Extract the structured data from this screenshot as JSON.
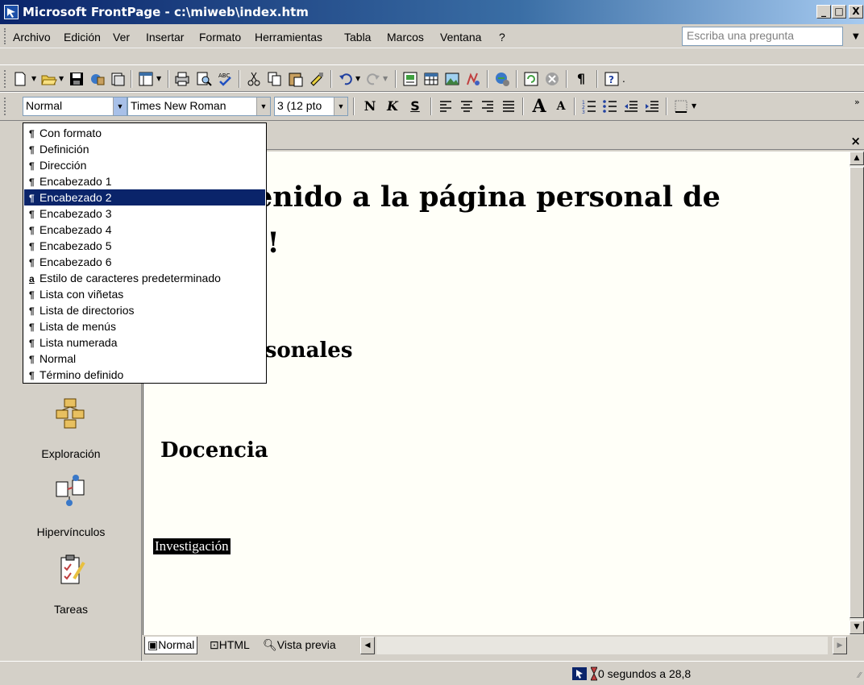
{
  "window": {
    "title": "Microsoft FrontPage - c:\\miweb\\index.htm",
    "minimize": "_",
    "maximize": "□",
    "close": "X"
  },
  "menubar": {
    "items": [
      "Archivo",
      "Edición",
      "Ver",
      "Insertar",
      "Formato",
      "Herramientas",
      "Tabla",
      "Marcos",
      "Ventana",
      "?"
    ],
    "ask_placeholder": "Escriba una pregunta"
  },
  "format_toolbar": {
    "style_value": "Normal",
    "font_value": "Times New Roman",
    "size_value": "3  (12 pto",
    "bold": "N",
    "italic": "K",
    "underline": "S",
    "grow_font": "A",
    "shrink_font": "A"
  },
  "style_dropdown": {
    "selected_index": 4,
    "items": [
      {
        "mark": "¶",
        "label": "Con formato"
      },
      {
        "mark": "¶",
        "label": "Definición"
      },
      {
        "mark": "¶",
        "label": "Dirección"
      },
      {
        "mark": "¶",
        "label": "Encabezado 1"
      },
      {
        "mark": "¶",
        "label": "Encabezado 2"
      },
      {
        "mark": "¶",
        "label": "Encabezado 3"
      },
      {
        "mark": "¶",
        "label": "Encabezado 4"
      },
      {
        "mark": "¶",
        "label": "Encabezado 5"
      },
      {
        "mark": "¶",
        "label": "Encabezado 6"
      },
      {
        "mark": "a",
        "label": "Estilo de caracteres predeterminado"
      },
      {
        "mark": "¶",
        "label": "Lista con viñetas"
      },
      {
        "mark": "¶",
        "label": "Lista de directorios"
      },
      {
        "mark": "¶",
        "label": "Lista de menús"
      },
      {
        "mark": "¶",
        "label": "Lista numerada"
      },
      {
        "mark": "¶",
        "label": "Normal"
      },
      {
        "mark": "¶",
        "label": "Término definido"
      }
    ]
  },
  "views": {
    "exploracion": "Exploración",
    "hipervinculos": "Hipervínculos",
    "tareas": "Tareas"
  },
  "document": {
    "heading_line1": "enido a la página personal de",
    "heading_line2": "!!",
    "section1": "rsonales",
    "section2": "Docencia",
    "selected_text": "Investigación"
  },
  "tab_close": "×",
  "view_tabs": {
    "normal": "Normal",
    "html": "HTML",
    "preview": "Vista previa"
  },
  "status": {
    "text": "0 segundos a 28,8"
  }
}
